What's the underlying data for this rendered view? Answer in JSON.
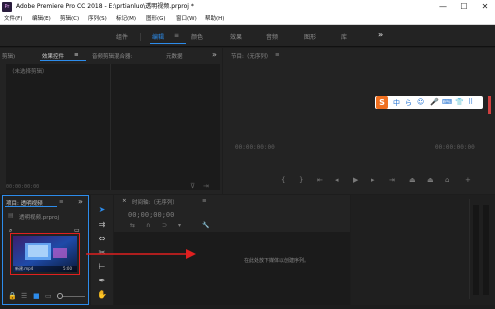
{
  "window": {
    "title": "Adobe Premiere Pro CC 2018 - E:\\prtianluo\\透明视频.prproj *",
    "app_icon_text": "Pr",
    "min_label": "—",
    "max_label": "☐",
    "close_label": "✕"
  },
  "menu": {
    "items": [
      "文件(F)",
      "编辑(E)",
      "剪辑(C)",
      "序列(S)",
      "标记(M)",
      "图形(G)",
      "窗口(W)",
      "帮助(H)"
    ]
  },
  "workspaces": {
    "tabs": [
      "组件",
      "编辑",
      "颜色",
      "效果",
      "音频",
      "图形",
      "库"
    ],
    "active": "编辑",
    "more_label": "»"
  },
  "source_panel": {
    "tabs": [
      "剪辑)",
      "效果控件",
      "音频剪辑混合器:",
      "元数据"
    ],
    "active_tab": "效果控件",
    "menu_glyph": "≡",
    "more_label": "»",
    "no_clip_text": "（未选择剪辑）",
    "timecode": "00:00:00:00"
  },
  "program_panel": {
    "title": "节目:（无序列）",
    "menu_glyph": "≡",
    "timecode_left": "00:00:00:00",
    "timecode_right": "00:00:00:00",
    "ime_bar": [
      "S",
      "中",
      "ら",
      "☺",
      "🎤",
      "⌨",
      "👕",
      "⠿"
    ]
  },
  "project_panel": {
    "title": "项目: 透明视频",
    "menu_glyph": "≡",
    "more_label": "»",
    "file_name": "透明视频.prproj",
    "clip_label": "新建.mp4",
    "clip_duration": "5:00"
  },
  "timeline_panel": {
    "title": "时间轴:（无序列）",
    "menu_glyph": "≡",
    "timecode": "00;00;00;00",
    "drop_hint": "在此处放下媒体以创建序列。",
    "close_label": "×"
  },
  "colors": {
    "accent": "#2d8ceb",
    "annotation_red": "#e02020",
    "ime_orange": "#f07020",
    "ime_blue": "#2070d0"
  }
}
